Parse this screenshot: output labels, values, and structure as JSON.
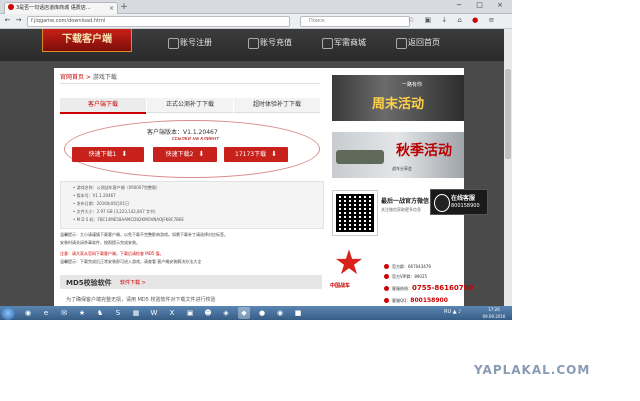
{
  "browser": {
    "tab_title": "3是否一句话店道库商城 语费店...",
    "tab_close": "×",
    "new_tab": "+",
    "window_buttons": "− □ ×",
    "back": "←",
    "forward": "→",
    "url": "f.jiqgame.com/download.html",
    "search_placeholder": "Поиск",
    "toolbar_icons": "☆ ▣ ↓ ⌂",
    "toolbar_icon_red": "●",
    "menu": "≡"
  },
  "site_header": {
    "download_client": "下载客户端",
    "nav": [
      "账号注册",
      "账号充值",
      "军需商城",
      "返回首页"
    ]
  },
  "breadcrumb": {
    "home": "官网首页",
    "sep": " > ",
    "current": "游戏下载"
  },
  "tabs": [
    "客户端下载",
    "正式公测补丁下载",
    "超时体验补丁下载"
  ],
  "download": {
    "version": "客户端版本：V1.1.20467",
    "note": "ссылки на клиент",
    "buttons": [
      "快速下载1",
      "快速下载2",
      "17173下载"
    ],
    "button_icon": "⬇"
  },
  "info_rows": [
    "• 游戏名称：公测战车客户端（090007完整版）",
    "• 版本号：V1.1.20467",
    "• 发布日期：2016年06月01日",
    "• 文件大小：2.97 GB (3,223,142,847 字节)",
    "• M D 5 码：FBC14ME58AAMCD82KMOVNAOJFK8C7B6E"
  ],
  "tips": [
    "温馨提示：大小请谨慎下载客户端，以免下载不完整影响游戏。如需下载补丁请选择对应标签。",
    "安装时请关闭杀毒软件，按照提示完成安装。",
    "注意：请大家从官网下载客户端，下载后请检查 MD5 值。",
    "温馨提示：下载完成后正常安装即可进入游戏，请查看 客户端安装解决办法大全"
  ],
  "md5_section": {
    "title": "MD5校验软件",
    "link": "软件下载 >",
    "text": "为了确保客户端完整无损，请用 MD5 校验软件对下载文件进行校验"
  },
  "sidebar": {
    "ad1_big": "周末活动",
    "ad1_small": "一路有你",
    "ad2_big": "秋季活动",
    "ad2_small": "战车分享会",
    "qr_title": "最后一战官方微信",
    "qr_sub": "关注微信获取更多信息",
    "service_title": "在线客服",
    "service_num": "800158900",
    "star_label": "中国战车",
    "contacts": [
      {
        "label": "官方群：",
        "value": "667043479",
        "style": "small"
      },
      {
        "label": "官方VIP群：",
        "value": "89025",
        "style": "small"
      },
      {
        "label": "客服热线：",
        "value": "0755-86160700",
        "style": "big"
      },
      {
        "label": "客服QQ：",
        "value": "800158900",
        "style": "mid"
      }
    ]
  },
  "taskbar": {
    "apps": [
      "◉",
      "e",
      "✉",
      "★",
      "♞",
      "S",
      "▦",
      "W",
      "X",
      "▣",
      "☻",
      "◈",
      "◆",
      "●",
      "◉",
      "■"
    ],
    "tray": "RU ▲ ♪",
    "time": "17:26",
    "date": "09.09.2016"
  },
  "watermark": "YAPLAKAL.COM"
}
